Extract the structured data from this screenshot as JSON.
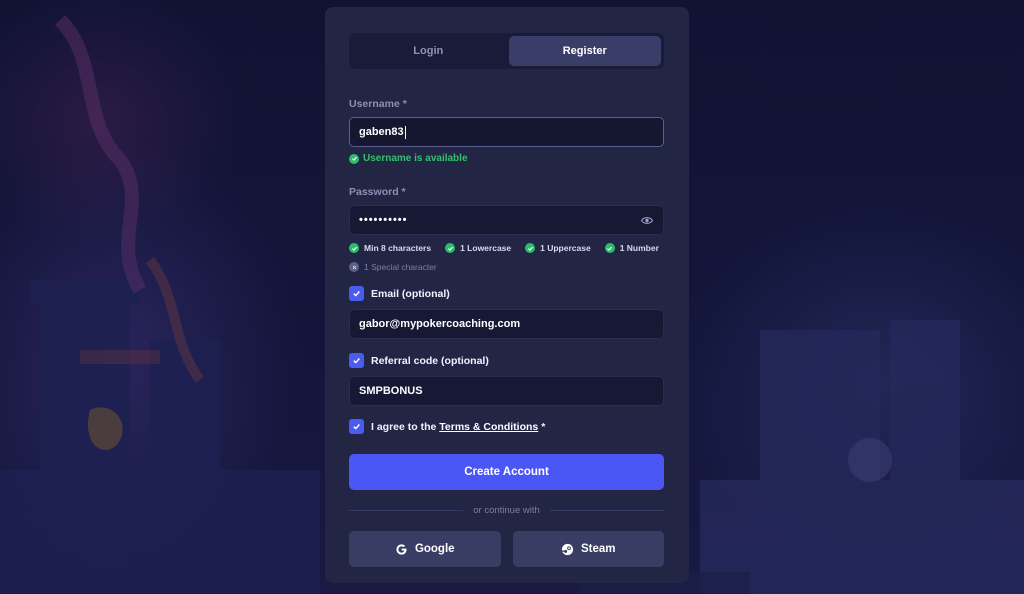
{
  "tabs": {
    "login": "Login",
    "register": "Register"
  },
  "username": {
    "label": "Username *",
    "value": "gaben83",
    "status": "Username is available"
  },
  "password": {
    "label": "Password *",
    "masked_value": "••••••••••",
    "requirements": [
      {
        "text": "Min 8 characters",
        "met": true
      },
      {
        "text": "1 Lowercase",
        "met": true
      },
      {
        "text": "1 Uppercase",
        "met": true
      },
      {
        "text": "1 Number",
        "met": true
      },
      {
        "text": "1 Special character",
        "met": false
      }
    ]
  },
  "email": {
    "label": "Email (optional)",
    "checked": true,
    "value": "gabor@mypokercoaching.com"
  },
  "referral": {
    "label": "Referral code (optional)",
    "checked": true,
    "value": "SMPBONUS"
  },
  "terms": {
    "prefix": "I agree to the",
    "link": "Terms & Conditions",
    "suffix": "*",
    "checked": true
  },
  "create_button": "Create Account",
  "divider_text": "or continue with",
  "social": {
    "google": "Google",
    "steam": "Steam"
  },
  "colors": {
    "accent": "#4b57f5",
    "success": "#2dbb6c",
    "card": "#232545"
  }
}
